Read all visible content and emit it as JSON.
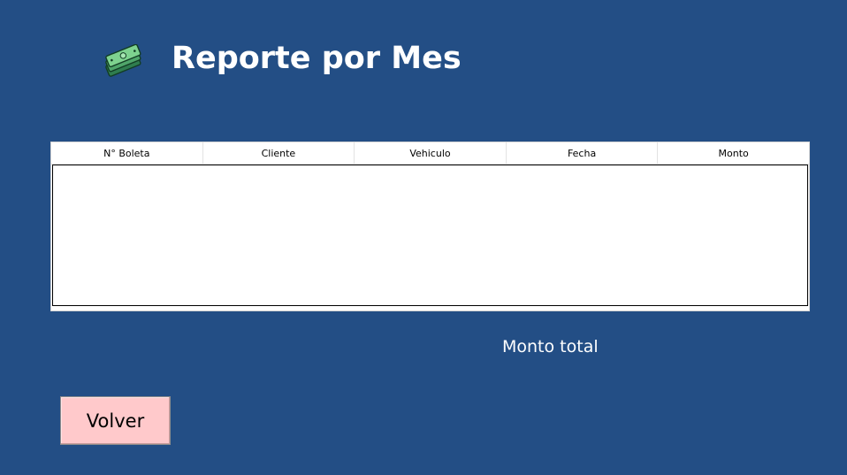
{
  "header": {
    "title": "Reporte por Mes",
    "icon": "money-stack-icon"
  },
  "table": {
    "columns": [
      "N° Boleta",
      "Cliente",
      "Vehiculo",
      "Fecha",
      "Monto"
    ],
    "rows": []
  },
  "summary": {
    "total_label": "Monto total"
  },
  "actions": {
    "back_label": "Volver"
  },
  "colors": {
    "background": "#234e85",
    "button": "#ffc9cb",
    "title": "#ffffff"
  }
}
